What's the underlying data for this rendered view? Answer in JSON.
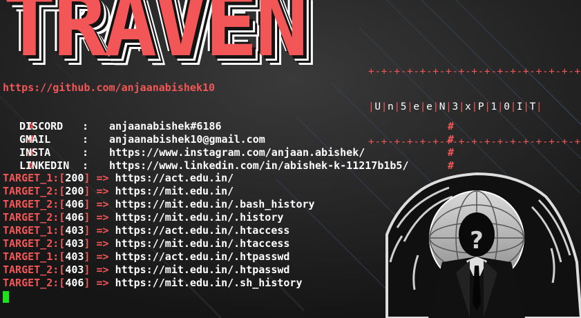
{
  "banner": {
    "title": "TRAVEN",
    "subtitle_border": "+-+-+-+-+-+-+-+-+-+-+-+-+-+-+-+-+-+",
    "subtitle_chars": [
      "U",
      "n",
      "5",
      "e",
      "e",
      "N",
      "3",
      "x",
      "P",
      "1",
      "0",
      "I",
      "T"
    ]
  },
  "github_url": "https://github.com/anjaanabishek10",
  "contacts": [
    {
      "hash": "#",
      "key": "DISCORD",
      "colon": ":",
      "value": "anjaanabishek#6186",
      "end_hash": "#"
    },
    {
      "hash": "#",
      "key": "GMAIL",
      "colon": ":",
      "value": "anjaanabishek10@gmail.com",
      "end_hash": "#"
    },
    {
      "hash": "#",
      "key": "INSTA",
      "colon": ":",
      "value": "https://www.instagram.com/anjaan.abishek/",
      "end_hash": "#"
    },
    {
      "hash": "#",
      "key": "LINKEDIN",
      "colon": ":",
      "value": "https://www.linkedin.com/in/abishek-k-11217b1b5/",
      "end_hash": "#"
    }
  ],
  "results": [
    {
      "target": "TARGET_1:[",
      "code": "200",
      "close": "]",
      "arrow": "=>",
      "url": "https://act.edu.in/"
    },
    {
      "target": "TARGET_2:[",
      "code": "200",
      "close": "]",
      "arrow": "=>",
      "url": "https://mit.edu.in/"
    },
    {
      "target": "TARGET_2:[",
      "code": "406",
      "close": "]",
      "arrow": "=>",
      "url": "https://mit.edu.in/.bash_history"
    },
    {
      "target": "TARGET_2:[",
      "code": "406",
      "close": "]",
      "arrow": "=>",
      "url": "https://mit.edu.in/.history"
    },
    {
      "target": "TARGET_1:[",
      "code": "403",
      "close": "]",
      "arrow": "=>",
      "url": "https://act.edu.in/.htaccess"
    },
    {
      "target": "TARGET_2:[",
      "code": "403",
      "close": "]",
      "arrow": "=>",
      "url": "https://mit.edu.in/.htaccess"
    },
    {
      "target": "TARGET_1:[",
      "code": "403",
      "close": "]",
      "arrow": "=>",
      "url": "https://act.edu.in/.htpasswd"
    },
    {
      "target": "TARGET_2:[",
      "code": "403",
      "close": "]",
      "arrow": "=>",
      "url": "https://mit.edu.in/.htpasswd"
    },
    {
      "target": "TARGET_2:[",
      "code": "406",
      "close": "]",
      "arrow": "=>",
      "url": "https://mit.edu.in/.sh_history"
    }
  ],
  "colors": {
    "background": "#1a1a1a",
    "accent_red": "#f25656",
    "text_white": "#ffffff",
    "cursor_green": "#19e319"
  },
  "icons": {
    "background_art": "hooded-anonymous-figure-globe-icon",
    "cursor": "block-cursor"
  }
}
